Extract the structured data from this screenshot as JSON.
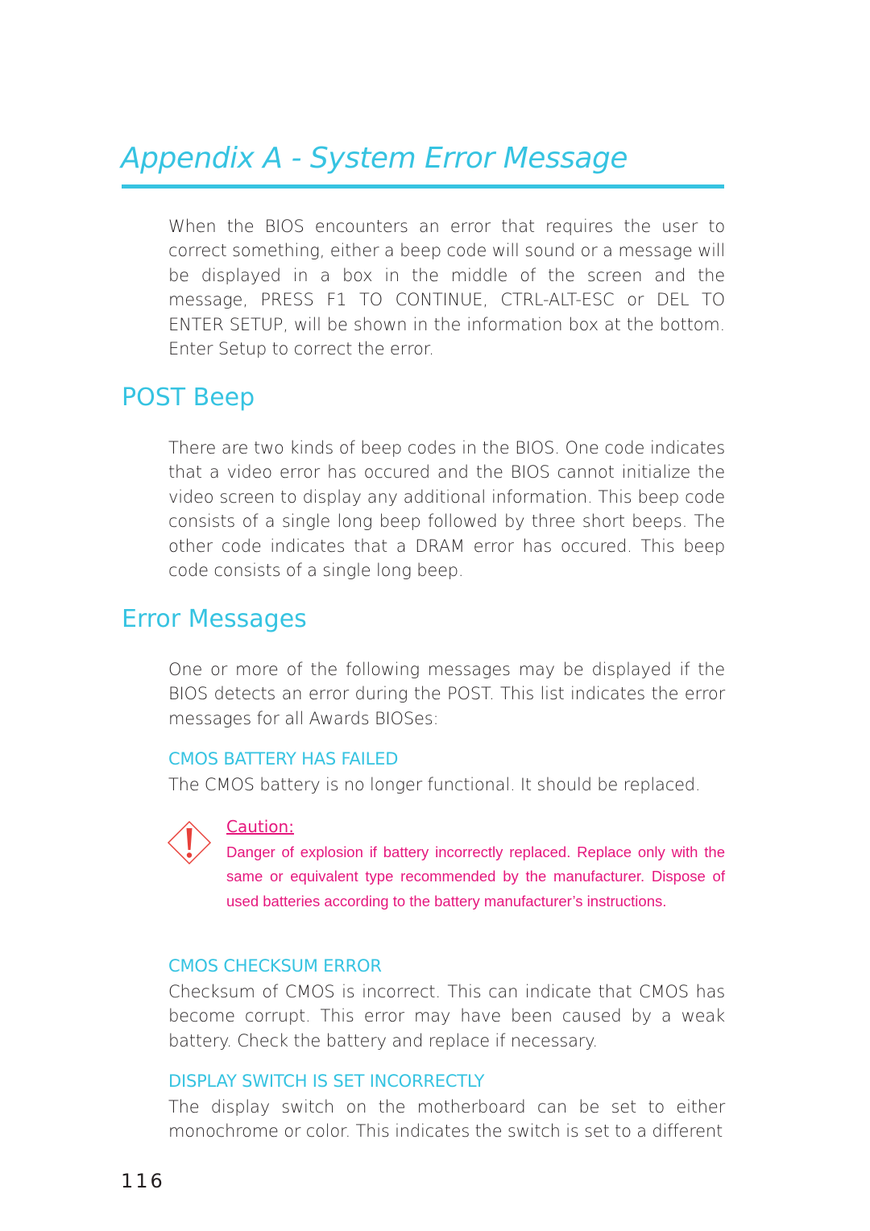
{
  "title": "Appendix A - System Error Message",
  "intro": "When the BIOS encounters an error that requires the user to correct something, either a beep code will sound or a message will be displayed in a box in the middle of the screen and the message, PRESS F1 TO CONTINUE, CTRL-ALT-ESC or DEL TO ENTER SETUP, will be shown in the information box at the bottom. Enter Setup to correct the error.",
  "post_beep": {
    "heading": "POST  Beep",
    "body": "There are two kinds of beep codes in the BIOS. One code indicates that a video error has occured and the BIOS cannot initialize the video screen to display any additional information. This beep code consists of a single long beep followed by three short beeps. The other code indicates that a DRAM error has occured. This beep code consists of a single long beep."
  },
  "error_messages": {
    "heading": "Error  Messages",
    "body": "One or more of the following messages may be displayed if the BIOS detects an error during the POST. This list indicates the error messages for all Awards BIOSes:",
    "items": [
      {
        "name": "CMOS BATTERY HAS FAILED",
        "desc": "The CMOS battery is no longer functional. It should be replaced."
      },
      {
        "name": "CMOS CHECKSUM ERROR",
        "desc": "Checksum of CMOS is incorrect. This can indicate that CMOS has become corrupt. This error may have been caused by a weak battery. Check the battery and replace if necessary."
      },
      {
        "name": "DISPLAY SWITCH IS SET INCORRECTLY",
        "desc": "The display switch on the motherboard can be set to either monochrome or color. This indicates the switch is set to a different"
      }
    ]
  },
  "caution": {
    "icon": "warning-diamond-icon",
    "label": "Caution:",
    "text": "Danger of explosion if battery incorrectly replaced. Replace only with the same or equivalent type recommended by the manufacturer. Dispose of used batteries according to the battery manufacturer’s instructions."
  },
  "page_number": "116",
  "colors": {
    "accent": "#36c3e1",
    "caution": "#e5177d",
    "caution_icon": "#e8403a",
    "text": "#231f20"
  }
}
